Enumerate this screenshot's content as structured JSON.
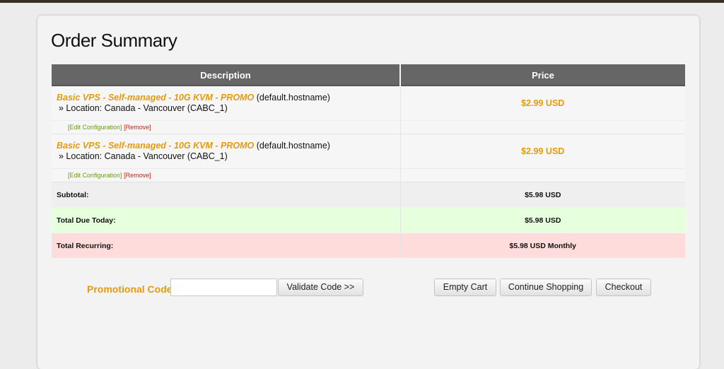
{
  "page": {
    "title": "Order Summary"
  },
  "table": {
    "headers": {
      "description": "Description",
      "price": "Price"
    },
    "items": [
      {
        "product": "Basic VPS - Self-managed - 10G KVM - PROMO",
        "hostname": "(default.hostname)",
        "location": "» Location: Canada - Vancouver (CABC_1)",
        "price": "$2.99 USD",
        "edit_label": "[Edit Configuration]",
        "remove_label": "[Remove]"
      },
      {
        "product": "Basic VPS - Self-managed - 10G KVM - PROMO",
        "hostname": "(default.hostname)",
        "location": "» Location: Canada - Vancouver (CABC_1)",
        "price": "$2.99 USD",
        "edit_label": "[Edit Configuration]",
        "remove_label": "[Remove]"
      }
    ],
    "subtotal": {
      "label": "Subtotal:",
      "value": "$5.98 USD"
    },
    "total_due": {
      "label": "Total Due Today:",
      "value": "$5.98 USD"
    },
    "total_recurring": {
      "label": "Total Recurring:",
      "value": "$5.98 USD Monthly"
    }
  },
  "promo": {
    "label": "Promotional Code",
    "value": "",
    "placeholder": "",
    "validate_label": "Validate Code >>"
  },
  "actions": {
    "empty_cart": "Empty Cart",
    "continue_shopping": "Continue Shopping",
    "checkout": "Checkout"
  },
  "colors": {
    "accent": "#e69a0c",
    "header_bg": "#666666",
    "due_bg": "#e6ffdc",
    "recurring_bg": "#ffdcdc",
    "edit_link": "#6a9a1a",
    "remove_link": "#c0261b"
  }
}
